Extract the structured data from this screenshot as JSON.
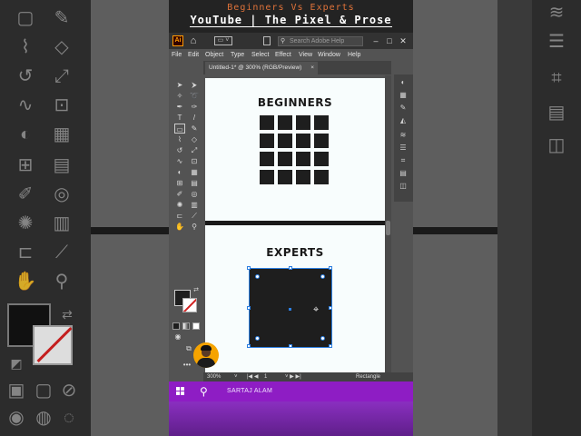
{
  "banner": {
    "subtitle": "Beginners Vs Experts",
    "channel": "YouTube | The Pixel & Prose"
  },
  "titlebar": {
    "app_logo": "Ai",
    "search_placeholder": "Search Adobe Help",
    "icons": [
      "home-icon",
      "workspace-icon",
      "panel-icon",
      "search-icon",
      "minimize-icon",
      "maximize-icon",
      "close-icon"
    ]
  },
  "menubar": {
    "items": [
      "File",
      "Edit",
      "Object",
      "Type",
      "Select",
      "Effect",
      "View",
      "Window",
      "Help"
    ]
  },
  "document": {
    "tab_title": "Untitled-1* @ 300% (RGB/Preview)",
    "close_glyph": "×"
  },
  "artboards": {
    "top_heading": "BEGINNERS",
    "bottom_heading": "EXPERTS",
    "grid_rows": 4,
    "grid_cols": 4
  },
  "statusbar": {
    "zoom": "300%",
    "artboard_number": "1",
    "current_tool": "Rectangle"
  },
  "taskbar": {
    "user_name": "SARTAJ ALAM"
  },
  "colors": {
    "accent_orange": "#e0733a",
    "taskbar_purple": "#8e1dc4",
    "selection_blue": "#2d7fe0",
    "artboard": "#f8fdfd",
    "fill_black": "#1e1e1e"
  }
}
